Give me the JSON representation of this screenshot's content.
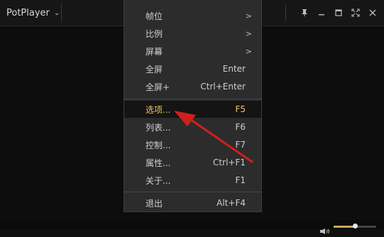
{
  "app": {
    "name": "PotPlayer"
  },
  "menu": {
    "items": [
      {
        "label": "帧位",
        "submenu_glyph": ">"
      },
      {
        "label": "比例",
        "submenu_glyph": ">"
      },
      {
        "label": "屏幕",
        "submenu_glyph": ">"
      },
      {
        "label": "全屏",
        "shortcut": "Enter"
      },
      {
        "label": "全屏+",
        "shortcut": "Ctrl+Enter"
      },
      {
        "label": "选项...",
        "shortcut": "F5",
        "highlighted": true
      },
      {
        "label": "列表...",
        "shortcut": "F6"
      },
      {
        "label": "控制...",
        "shortcut": "F7"
      },
      {
        "label": "属性...",
        "shortcut": "Ctrl+F1"
      },
      {
        "label": "关于...",
        "shortcut": "F1"
      },
      {
        "label": "退出",
        "shortcut": "Alt+F4"
      }
    ]
  },
  "window_controls": [
    "pin-icon",
    "minimize-icon",
    "maximize-icon",
    "fullscreen-icon",
    "close-icon"
  ],
  "annotation": {
    "type": "arrow",
    "color": "#d0201c",
    "points_to": "选项..."
  },
  "volume": {
    "level": 0.5
  },
  "colors": {
    "highlight_text": "#f0c95c",
    "menu_bg": "#2c2c2c",
    "arrow": "#d0201c"
  }
}
